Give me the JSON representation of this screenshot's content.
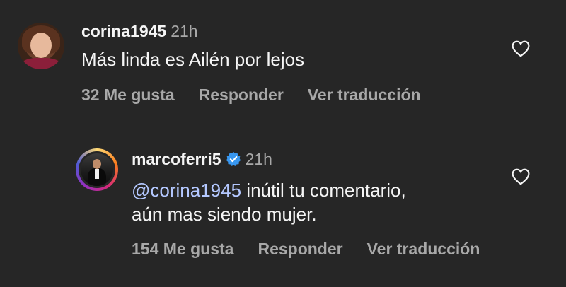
{
  "comments": [
    {
      "username": "corina1945",
      "time": "21h",
      "text": "Más linda es Ailén por lejos",
      "likes": "32 Me gusta",
      "reply": "Responder",
      "translate": "Ver traducción"
    },
    {
      "username": "marcoferri5",
      "time": "21h",
      "verified": true,
      "mention": "@corina1945",
      "text_line1_rest": " inútil tu comentario,",
      "text_line2": "aún mas siendo mujer.",
      "likes": "154 Me gusta",
      "reply": "Responder",
      "translate": "Ver traducción"
    }
  ],
  "icons": {
    "like": "heart-outline-icon",
    "verified": "verified-badge-icon"
  },
  "colors": {
    "background": "#262626",
    "text": "#f5f5f5",
    "secondary": "#a8a8a8",
    "mention": "#b4c8ff",
    "verified": "#3897f0"
  }
}
